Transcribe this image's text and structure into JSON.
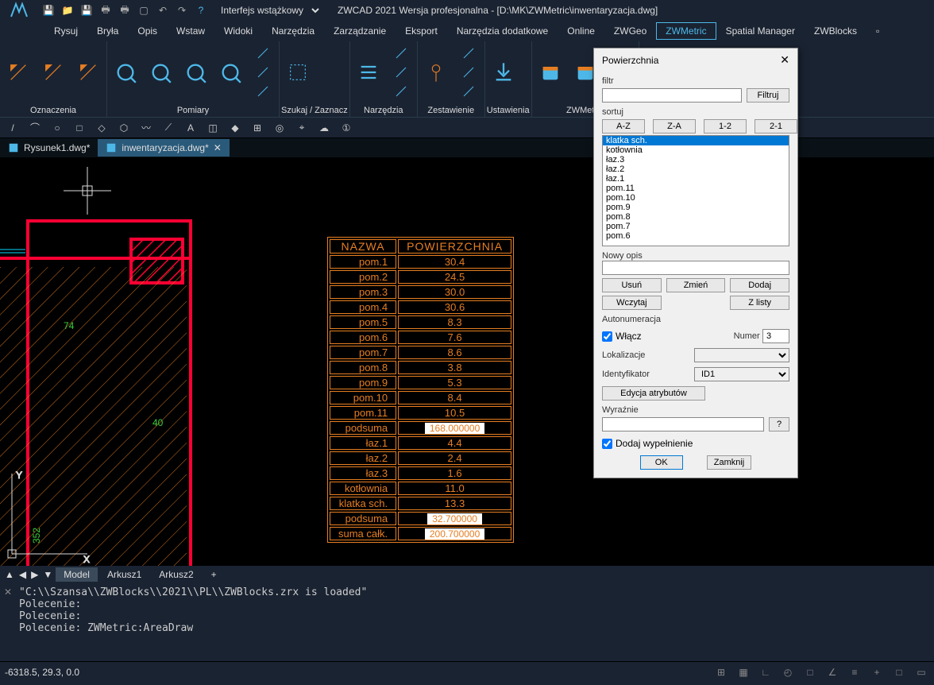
{
  "titlebar": {
    "workspace_label": "Interfejs wstążkowy",
    "title": "ZWCAD 2021 Wersja profesjonalna - [D:\\MK\\ZWMetric\\inwentaryzacja.dwg]"
  },
  "menubar": {
    "items": [
      "Rysuj",
      "Bryła",
      "Opis",
      "Wstaw",
      "Widoki",
      "Narzędzia",
      "Zarządzanie",
      "Eksport",
      "Narzędzia dodatkowe",
      "Online",
      "ZWGeo",
      "ZWMetric",
      "Spatial Manager",
      "ZWBlocks"
    ],
    "active_index": 11
  },
  "ribbon": {
    "groups": [
      {
        "label": "Oznaczenia"
      },
      {
        "label": "Pomiary"
      },
      {
        "label": "Szukaj / Zaznacz"
      },
      {
        "label": "Narzędzia"
      },
      {
        "label": "Zestawienie"
      },
      {
        "label": "Ustawienia"
      },
      {
        "label": "ZWMetric"
      }
    ]
  },
  "doctabs": {
    "tabs": [
      {
        "label": "Rysunek1.dwg*"
      },
      {
        "label": "inwentaryzacja.dwg*"
      }
    ],
    "active_index": 1
  },
  "drawing": {
    "dims": [
      "74",
      "40",
      "352"
    ],
    "table": {
      "headers": [
        "NAZWA",
        "POWIERZCHNIA"
      ],
      "rows": [
        [
          "pom.1",
          "30.4"
        ],
        [
          "pom.2",
          "24.5"
        ],
        [
          "pom.3",
          "30.0"
        ],
        [
          "pom.4",
          "30.6"
        ],
        [
          "pom.5",
          "8.3"
        ],
        [
          "pom.6",
          "7.6"
        ],
        [
          "pom.7",
          "8.6"
        ],
        [
          "pom.8",
          "3.8"
        ],
        [
          "pom.9",
          "5.3"
        ],
        [
          "pom.10",
          "8.4"
        ],
        [
          "pom.11",
          "10.5"
        ],
        [
          "podsuma",
          "168.000000"
        ],
        [
          "łaz.1",
          "4.4"
        ],
        [
          "łaz.2",
          "2.4"
        ],
        [
          "łaz.3",
          "1.6"
        ],
        [
          "kotłownia",
          "11.0"
        ],
        [
          "klatka sch.",
          "13.3"
        ],
        [
          "podsuma",
          "32.700000"
        ],
        [
          "suma całk.",
          "200.700000"
        ]
      ]
    }
  },
  "layout_tabs": {
    "tabs": [
      "Model",
      "Arkusz1",
      "Arkusz2"
    ],
    "active_index": 0,
    "plus": "+"
  },
  "command": {
    "lines": "\"C:\\\\Szansa\\\\ZWBlocks\\\\2021\\\\PL\\\\ZWBlocks.zrx is loaded\"\nPolecenie:\nPolecenie:\nPolecenie: ZWMetric:AreaDraw\n"
  },
  "statusbar": {
    "coords": "-6318.5, 29.3, 0.0"
  },
  "dialog": {
    "title": "Powierzchnia",
    "filtr_label": "filtr",
    "filtr_btn": "Filtruj",
    "sortuj_label": "sortuj",
    "sort_btns": [
      "A-Z",
      "Z-A",
      "1-2",
      "2-1"
    ],
    "list_items": [
      "klatka sch.",
      "kotłownia",
      "łaz.3",
      "łaz.2",
      "łaz.1",
      "pom.11",
      "pom.10",
      "pom.9",
      "pom.8",
      "pom.7",
      "pom.6"
    ],
    "nowy_opis_label": "Nowy opis",
    "usun": "Usuń",
    "zmien": "Zmień",
    "dodaj": "Dodaj",
    "wczytaj": "Wczytaj",
    "z_listy": "Z listy",
    "auton_label": "Autonumeracja",
    "wlacz": "Włącz",
    "numer_label": "Numer",
    "numer_val": "3",
    "lokal_label": "Lokalizacje",
    "ident_label": "Identyfikator",
    "ident_val": "ID1",
    "edycja": "Edycja atrybutów",
    "wyraz_label": "Wyraźnie",
    "qmark": "?",
    "dodaj_wyp": "Dodaj wypełnienie",
    "ok": "OK",
    "zamknij": "Zamknij"
  }
}
